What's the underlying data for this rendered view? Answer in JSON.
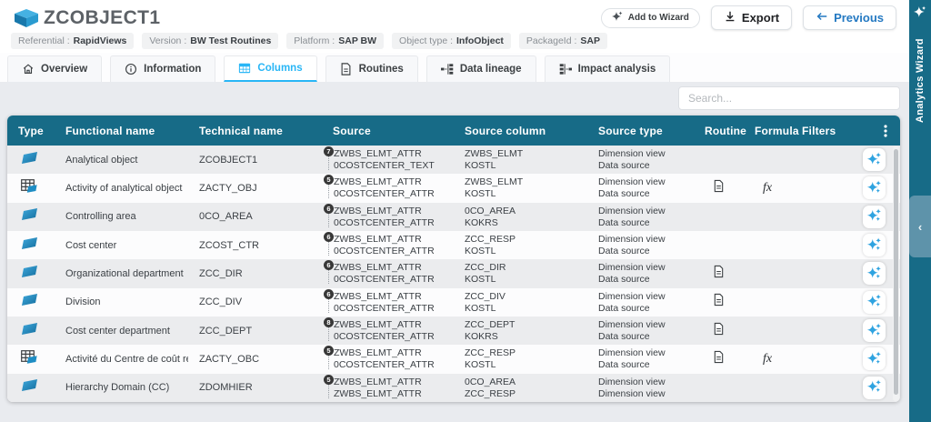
{
  "colors": {
    "table_header": "#176b87",
    "rail": "#176b87",
    "accent_blue": "#29b6f6",
    "icon_blue": "#1e8dc4",
    "previous_text": "#2479c2"
  },
  "header": {
    "title": "ZCOBJECT1",
    "meta": [
      {
        "label": "Referential :",
        "value": "RapidViews"
      },
      {
        "label": "Version :",
        "value": "BW Test Routines"
      },
      {
        "label": "Platform :",
        "value": "SAP BW"
      },
      {
        "label": "Object type :",
        "value": "InfoObject"
      },
      {
        "label": "PackageId :",
        "value": "SAP"
      }
    ],
    "actions": {
      "add_to_wizard": "Add to Wizard",
      "export": "Export",
      "previous": "Previous"
    }
  },
  "tabs": [
    {
      "label": "Overview",
      "icon": "home-icon",
      "active": false
    },
    {
      "label": "Information",
      "icon": "info-icon",
      "active": false
    },
    {
      "label": "Columns",
      "icon": "grid-icon",
      "active": true
    },
    {
      "label": "Routines",
      "icon": "doc-icon",
      "active": false
    },
    {
      "label": "Data lineage",
      "icon": "lineage-icon",
      "active": false
    },
    {
      "label": "Impact analysis",
      "icon": "impact-icon",
      "active": false
    }
  ],
  "search": {
    "placeholder": "Search..."
  },
  "rail": {
    "label": "Analytics Wizard"
  },
  "table": {
    "columns": [
      "Type",
      "Functional name",
      "Technical name",
      "Source",
      "Source column",
      "Source type",
      "Routine",
      "Formula",
      "Filters"
    ],
    "formula_glyph": "fx",
    "rows": [
      {
        "type_icon": "dimension-icon",
        "functional_name": "Analytical object",
        "technical_name": "ZCOBJECT1",
        "source_badge": "7",
        "sources": [
          "ZWBS_ELMT_ATTR",
          "0COSTCENTER_TEXT"
        ],
        "source_columns": [
          "ZWBS_ELMT",
          "KOSTL"
        ],
        "source_types": [
          "Dimension view",
          "Data source"
        ],
        "has_routine": false,
        "has_formula": false
      },
      {
        "type_icon": "table-icon",
        "functional_name": "Activity of analytical object",
        "technical_name": "ZACTY_OBJ",
        "source_badge": "5",
        "sources": [
          "ZWBS_ELMT_ATTR",
          "0COSTCENTER_ATTR"
        ],
        "source_columns": [
          "ZWBS_ELMT",
          "KOSTL"
        ],
        "source_types": [
          "Dimension view",
          "Data source"
        ],
        "has_routine": true,
        "has_formula": true
      },
      {
        "type_icon": "dimension-icon",
        "functional_name": "Controlling area",
        "technical_name": "0CO_AREA",
        "source_badge": "6",
        "sources": [
          "ZWBS_ELMT_ATTR",
          "0COSTCENTER_ATTR"
        ],
        "source_columns": [
          "0CO_AREA",
          "KOKRS"
        ],
        "source_types": [
          "Dimension view",
          "Data source"
        ],
        "has_routine": false,
        "has_formula": false
      },
      {
        "type_icon": "dimension-icon",
        "functional_name": "Cost center",
        "technical_name": "ZCOST_CTR",
        "source_badge": "6",
        "sources": [
          "ZWBS_ELMT_ATTR",
          "0COSTCENTER_ATTR"
        ],
        "source_columns": [
          "ZCC_RESP",
          "KOSTL"
        ],
        "source_types": [
          "Dimension view",
          "Data source"
        ],
        "has_routine": false,
        "has_formula": false
      },
      {
        "type_icon": "dimension-icon",
        "functional_name": "Organizational department",
        "technical_name": "ZCC_DIR",
        "source_badge": "6",
        "sources": [
          "ZWBS_ELMT_ATTR",
          "0COSTCENTER_ATTR"
        ],
        "source_columns": [
          "ZCC_DIR",
          "KOSTL"
        ],
        "source_types": [
          "Dimension view",
          "Data source"
        ],
        "has_routine": true,
        "has_formula": false
      },
      {
        "type_icon": "dimension-icon",
        "functional_name": "Division",
        "technical_name": "ZCC_DIV",
        "source_badge": "6",
        "sources": [
          "ZWBS_ELMT_ATTR",
          "0COSTCENTER_ATTR"
        ],
        "source_columns": [
          "ZCC_DIV",
          "KOSTL"
        ],
        "source_types": [
          "Dimension view",
          "Data source"
        ],
        "has_routine": true,
        "has_formula": false
      },
      {
        "type_icon": "dimension-icon",
        "functional_name": "Cost center department",
        "technical_name": "ZCC_DEPT",
        "source_badge": "8",
        "sources": [
          "ZWBS_ELMT_ATTR",
          "0COSTCENTER_ATTR"
        ],
        "source_columns": [
          "ZCC_DEPT",
          "KOKRS"
        ],
        "source_types": [
          "Dimension view",
          "Data source"
        ],
        "has_routine": true,
        "has_formula": false
      },
      {
        "type_icon": "table-icon",
        "functional_name": "Activité du Centre de coût resp. ...",
        "technical_name": "ZACTY_OBC",
        "source_badge": "5",
        "sources": [
          "ZWBS_ELMT_ATTR",
          "0COSTCENTER_ATTR"
        ],
        "source_columns": [
          "ZCC_RESP",
          "KOSTL"
        ],
        "source_types": [
          "Dimension view",
          "Data source"
        ],
        "has_routine": true,
        "has_formula": true
      },
      {
        "type_icon": "dimension-icon",
        "functional_name": "Hierarchy Domain (CC)",
        "technical_name": "ZDOMHIER",
        "source_badge": "5",
        "sources": [
          "ZWBS_ELMT_ATTR",
          "ZWBS_ELMT_ATTR"
        ],
        "source_columns": [
          "0CO_AREA",
          "ZCC_RESP"
        ],
        "source_types": [
          "Dimension view",
          "Dimension view"
        ],
        "has_routine": false,
        "has_formula": false
      }
    ]
  }
}
